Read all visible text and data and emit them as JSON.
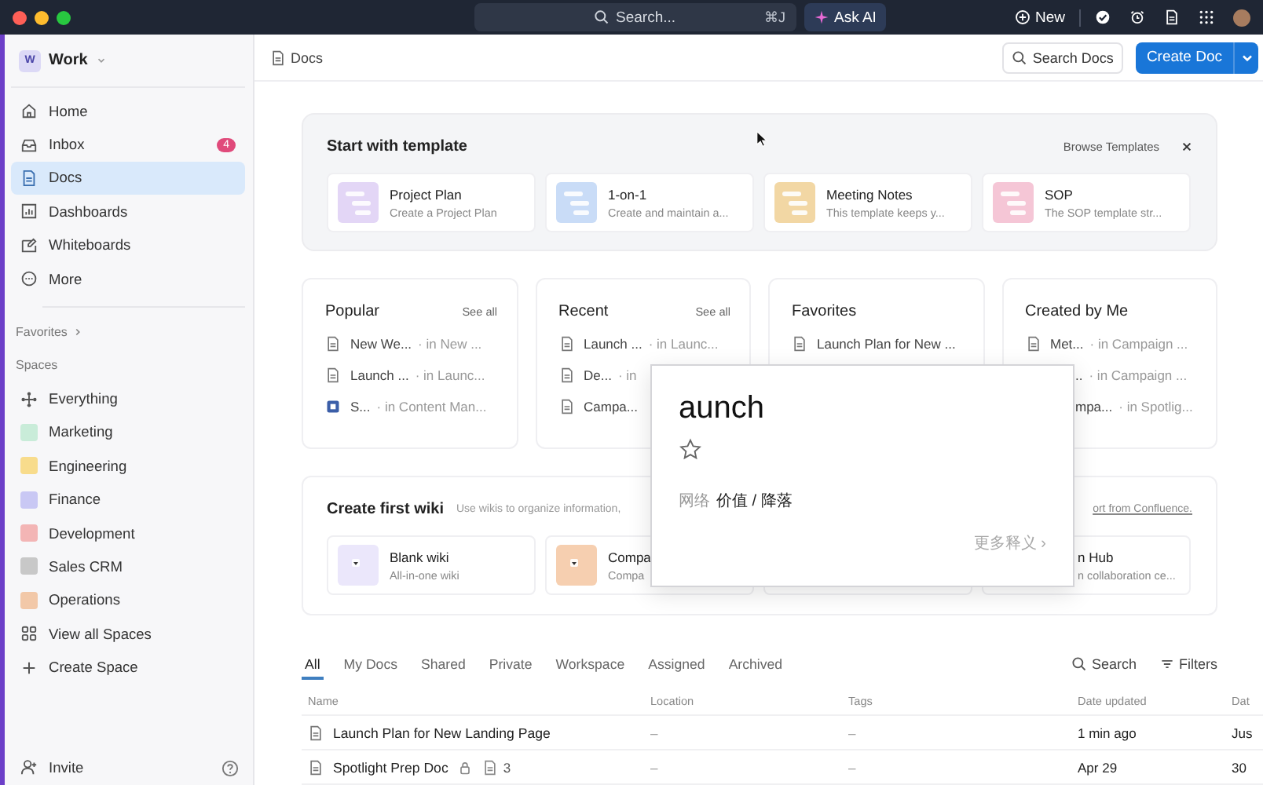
{
  "top_bar": {
    "search": {
      "placeholder": "Search...",
      "shortcut": "⌘J"
    },
    "ask_ai": "Ask AI",
    "new_button": "New"
  },
  "sidebar": {
    "workspace": {
      "initial": "W",
      "name": "Work"
    },
    "nav": [
      {
        "label": "Home",
        "selected": false
      },
      {
        "label": "Inbox",
        "badge": "4",
        "selected": false
      },
      {
        "label": "Docs",
        "selected": true
      },
      {
        "label": "Dashboards",
        "selected": false
      },
      {
        "label": "Whiteboards",
        "selected": false
      },
      {
        "label": "More",
        "selected": false
      }
    ],
    "favorites": "Favorites",
    "spaces_heading": "Spaces",
    "everything": "Everything",
    "spaces": [
      {
        "label": "Marketing",
        "color": "#c9ecd9"
      },
      {
        "label": "Engineering",
        "color": "#f8dc8c"
      },
      {
        "label": "Finance",
        "color": "#c9c8f4"
      },
      {
        "label": "Development",
        "color": "#f3b5b5"
      },
      {
        "label": "Sales CRM",
        "color": "#c8c8c8"
      },
      {
        "label": "Operations",
        "color": "#f2c8a8"
      }
    ],
    "actions": [
      "View all Spaces",
      "Create Space"
    ],
    "invite": "Invite"
  },
  "header": {
    "breadcrumb": "Docs",
    "search_docs": "Search Docs",
    "create_doc": "Create Doc"
  },
  "templates": {
    "title": "Start with template",
    "browse": "Browse Templates",
    "items": [
      {
        "title": "Project Plan",
        "description": "Create a Project Plan",
        "color": "#e3d6f6"
      },
      {
        "title": "1-on-1",
        "description": "Create and maintain a...",
        "color": "#c9dcf7"
      },
      {
        "title": "Meeting Notes",
        "description": "This template keeps y...",
        "color": "#f2d7a4"
      },
      {
        "title": "SOP",
        "description": "The SOP template str...",
        "color": "#f5c6d6"
      }
    ]
  },
  "sections": [
    {
      "title": "Popular",
      "see_all": "See all",
      "items": [
        {
          "kind": "doc",
          "name": "New We...",
          "location": "· in New ..."
        },
        {
          "kind": "doc",
          "name": "Launch ...",
          "location": "· in Launc..."
        },
        {
          "kind": "wiki",
          "name": "S...",
          "location": "· in Content Man..."
        }
      ]
    },
    {
      "title": "Recent",
      "see_all": "See all",
      "items": [
        {
          "kind": "doc",
          "name": "Launch ...",
          "location": "· in Launc..."
        },
        {
          "kind": "doc",
          "name": "De...",
          "location": "· in"
        },
        {
          "kind": "doc",
          "name": "Campa..."
        }
      ]
    },
    {
      "title": "Favorites",
      "items": [
        {
          "kind": "doc",
          "name": "Launch Plan for New ..."
        }
      ]
    },
    {
      "title": "Created by Me",
      "items": [
        {
          "kind": "doc",
          "name": "Met...",
          "location": "· in Campaign ..."
        },
        {
          "kind": "partial",
          "name": "..",
          "location": "· in Campaign ..."
        },
        {
          "kind": "partial",
          "name": "mpa...",
          "location": "· in Spotlig..."
        }
      ]
    }
  ],
  "wiki": {
    "title": "Create first wiki",
    "description": "Use wikis to organize information,",
    "link": "ort from Confluence.",
    "items": [
      {
        "kind": "card",
        "title": "Blank wiki",
        "description": "All-in-one wiki",
        "color": "#ebe7fb"
      },
      {
        "kind": "card",
        "title": "Compa",
        "description": "Compa",
        "color": "#f6cfb0"
      },
      {
        "kind": "hidden"
      },
      {
        "kind": "partial",
        "title": "n Hub",
        "description": "n collaboration ce..."
      }
    ]
  },
  "tabs": [
    {
      "label": "All",
      "selected": true
    },
    {
      "label": "My Docs",
      "selected": false
    },
    {
      "label": "Shared",
      "selected": false
    },
    {
      "label": "Private",
      "selected": false
    },
    {
      "label": "Workspace",
      "selected": false
    },
    {
      "label": "Assigned",
      "selected": false
    },
    {
      "label": "Archived",
      "selected": false
    }
  ],
  "table_tools": {
    "search": "Search",
    "filters": "Filters"
  },
  "table": {
    "columns": [
      "Name",
      "Location",
      "Tags",
      "Date updated",
      "Dat"
    ],
    "rows": [
      {
        "name": "Launch Plan for New Landing Page",
        "private": false,
        "location": "–",
        "tags": "–",
        "updated": "1 min ago",
        "column_5": "Jus"
      },
      {
        "name": "Spotlight Prep Doc",
        "private": true,
        "pages": "3",
        "location": "–",
        "tags": "–",
        "updated": "Apr 29",
        "column_5": "30"
      }
    ]
  },
  "popup": {
    "word": "aunch",
    "starred": false,
    "label": "网络",
    "meaning": "价值 / 降落",
    "more": "更多释义 ›"
  }
}
